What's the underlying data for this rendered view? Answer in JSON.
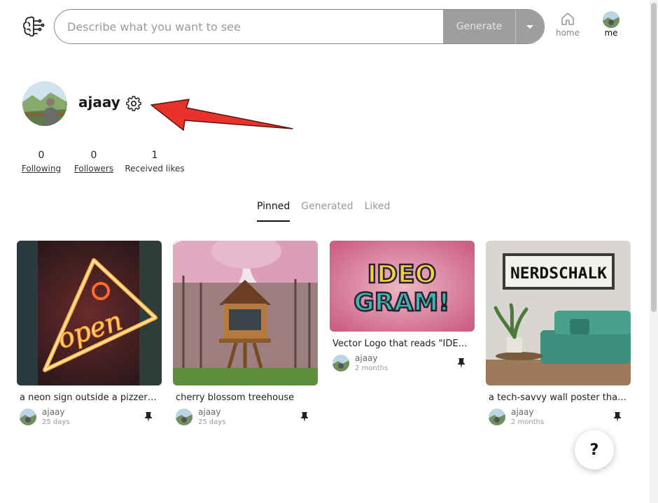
{
  "header": {
    "search_placeholder": "Describe what you want to see",
    "generate_label": "Generate",
    "nav_home": "home",
    "nav_me": "me"
  },
  "profile": {
    "username": "ajaay",
    "stats": [
      {
        "value": "0",
        "label": "Following"
      },
      {
        "value": "0",
        "label": "Followers"
      },
      {
        "value": "1",
        "label": "Received likes"
      }
    ]
  },
  "tabs": [
    "Pinned",
    "Generated",
    "Liked"
  ],
  "cards": [
    {
      "caption": "a neon sign outside a pizzeria that reads \"open\"",
      "user": "ajaay",
      "time": "25 days"
    },
    {
      "caption": "cherry blossom treehouse",
      "user": "ajaay",
      "time": "25 days"
    },
    {
      "caption": "Vector Logo that reads \"IDEOGRAM!\"",
      "user": "ajaay",
      "time": "2 months"
    },
    {
      "caption": "a tech-savvy wall poster that reads \"NERDSCHALK\"",
      "user": "ajaay",
      "time": "2 months"
    }
  ],
  "art_text": {
    "neon": "open",
    "logo_line1": "IDEO",
    "logo_line2": "GRAM!",
    "poster": "NERDSCHALK"
  },
  "help_label": "?",
  "colors": {
    "accent": "#111111",
    "generate_bg": "#9e9e9e",
    "arrow": "#e8322b"
  }
}
